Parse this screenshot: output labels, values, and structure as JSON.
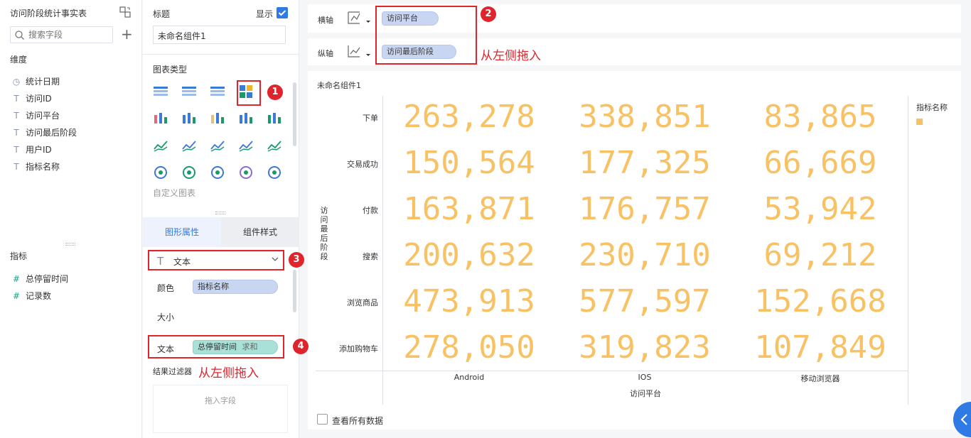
{
  "left": {
    "title": "访问阶段统计事实表",
    "search_placeholder": "搜索字段",
    "dims_label": "维度",
    "dims": [
      {
        "icon": "clock-icon",
        "label": "统计日期"
      },
      {
        "icon": "text-type-icon",
        "label": "访问ID"
      },
      {
        "icon": "text-type-icon",
        "label": "访问平台"
      },
      {
        "icon": "text-type-icon",
        "label": "访问最后阶段"
      },
      {
        "icon": "text-type-icon",
        "label": "用户ID"
      },
      {
        "icon": "text-type-icon",
        "label": "指标名称"
      }
    ],
    "measures_label": "指标",
    "measures": [
      {
        "icon": "hash-icon",
        "label": "总停留时间"
      },
      {
        "icon": "hash-icon",
        "label": "记录数"
      }
    ]
  },
  "mid": {
    "title_label": "标题",
    "show_label": "显示",
    "title_value": "未命名组件1",
    "chart_type_label": "图表类型",
    "custom_chart": "自定义图表",
    "tabs": [
      "图形属性",
      "组件样式"
    ],
    "mark_type": "文本",
    "color_label": "颜色",
    "color_field": "指标名称",
    "size_label": "大小",
    "text_label": "文本",
    "text_field": "总停留时间",
    "text_agg": "求和",
    "filter_label": "结果过滤器",
    "drag_hint": "拖入字段",
    "drag_from_left": "从左侧拖入"
  },
  "axes": {
    "x_label": "横轴",
    "x_field": "访问平台",
    "y_label": "纵轴",
    "y_field": "访问最后阶段",
    "drag_from_left": "从左侧拖入"
  },
  "badges": [
    "1",
    "2",
    "3",
    "4"
  ],
  "component_title": "未命名组件1",
  "legend": {
    "title": "指标名称",
    "color": "#f8c164"
  },
  "view_all": "查看所有数据",
  "colors": {
    "accent": "#2f7ae5",
    "highlight": "#e0242c",
    "value": "#f8c164"
  },
  "chart_data": {
    "type": "table",
    "x_categories": [
      "Android",
      "IOS",
      "移动浏览器"
    ],
    "y_categories": [
      "下单",
      "交易成功",
      "付款",
      "搜索",
      "浏览商品",
      "添加购物车"
    ],
    "xlabel": "访问平台",
    "ylabel": "访问最后阶段",
    "values": [
      [
        "263,278",
        "338,851",
        "83,865"
      ],
      [
        "150,564",
        "177,325",
        "66,669"
      ],
      [
        "163,871",
        "176,757",
        "53,942"
      ],
      [
        "200,632",
        "230,710",
        "69,212"
      ],
      [
        "473,913",
        "577,597",
        "152,668"
      ],
      [
        "278,050",
        "319,823",
        "107,849"
      ]
    ]
  }
}
